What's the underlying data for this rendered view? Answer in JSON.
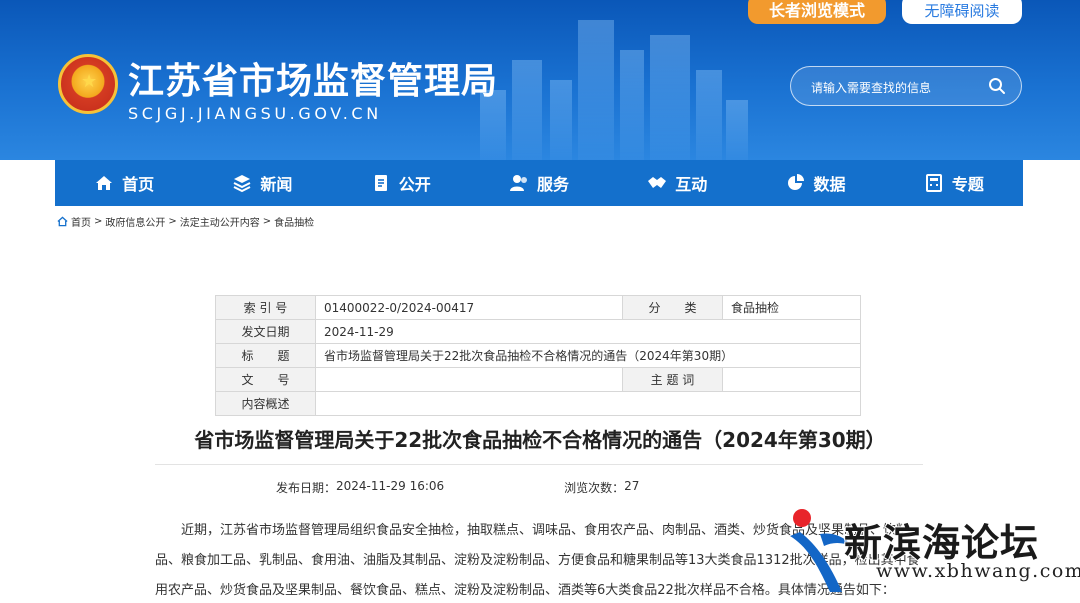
{
  "header": {
    "site_title": "江苏省市场监督管理局",
    "site_domain": "SCJGJ.JIANGSU.GOV.CN",
    "senior_mode_label": "长者浏览模式",
    "accessible_label": "无障碍阅读",
    "search_placeholder": "请输入需要查找的信息"
  },
  "nav": {
    "items": [
      {
        "label": "首页",
        "icon": "home-icon"
      },
      {
        "label": "新闻",
        "icon": "layers-icon"
      },
      {
        "label": "公开",
        "icon": "document-icon"
      },
      {
        "label": "服务",
        "icon": "users-icon"
      },
      {
        "label": "互动",
        "icon": "handshake-icon"
      },
      {
        "label": "数据",
        "icon": "pie-chart-icon"
      },
      {
        "label": "专题",
        "icon": "calculator-icon"
      }
    ]
  },
  "breadcrumb": {
    "items": [
      "首页",
      "政府信息公开",
      "法定主动公开内容",
      "食品抽检"
    ],
    "separator": ">"
  },
  "meta": {
    "index_label": "索 引 号",
    "index_value": "01400022-0/2024-00417",
    "category_label": "分　　类",
    "category_value": "食品抽检",
    "date_label": "发文日期",
    "date_value": "2024-11-29",
    "title_label": "标　　题",
    "title_value": "省市场监督管理局关于22批次食品抽检不合格情况的通告（2024年第30期）",
    "docno_label": "文　　号",
    "docno_value": "",
    "keyword_label": "主 题 词",
    "keyword_value": "",
    "summary_label": "内容概述",
    "summary_value": ""
  },
  "article": {
    "title": "省市场监督管理局关于22批次食品抽检不合格情况的通告（2024年第30期）",
    "publish_label": "发布日期：",
    "publish_value": "2024-11-29 16:06",
    "views_label": "浏览次数：",
    "views_value": "27",
    "para_line1": "近期，江苏省市场监督管理局组织食品安全抽检，抽取糕点、调味品、食用农产品、肉制品、酒类、炒货食品及坚果制品、饮料、",
    "para_line2": "品、粮食加工品、乳制品、食用油、油脂及其制品、淀粉及淀粉制品、方便食品和糖果制品等13大类食品1312批次样品，检出其中食",
    "para_line3": "用农产品、炒货食品及坚果制品、餐饮食品、糕点、淀粉及淀粉制品、酒类等6大类食品22批次样品不合格。具体情况通告如下："
  },
  "watermark": {
    "name": "新滨海论坛",
    "url": "www.xbhwang.com"
  },
  "colors": {
    "header_blue": "#1a72d2",
    "nav_blue": "#1470cc",
    "senior_orange": "#f29a2e"
  }
}
